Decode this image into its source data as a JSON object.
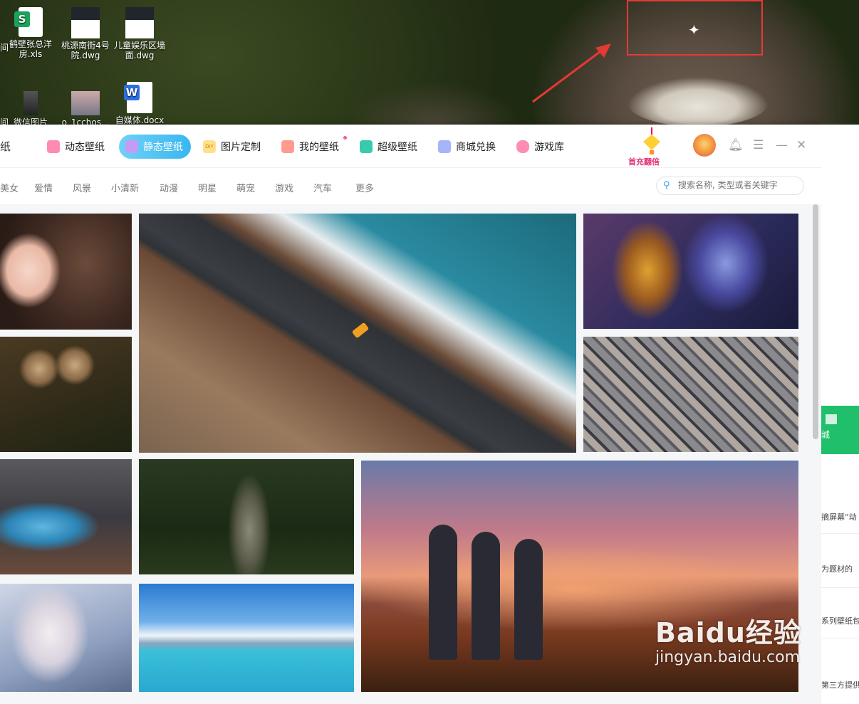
{
  "desktop": {
    "icons": [
      {
        "label": "鹤壁张总洋\n房.xls",
        "type": "xls"
      },
      {
        "label": "桃源南街4号\n院.dwg",
        "type": "dwg"
      },
      {
        "label": "儿童娱乐区墙\n面.dwg",
        "type": "dwg"
      },
      {
        "label": "微信图片",
        "type": "image"
      },
      {
        "label": "o_1cchos...",
        "type": "image"
      },
      {
        "label": "自媒体.docx",
        "type": "docx"
      }
    ],
    "left_edge_text": [
      "间",
      "间"
    ]
  },
  "app": {
    "logo_fragment": "纸",
    "nav": [
      {
        "label": "动态壁纸",
        "color": "#ff6fa0"
      },
      {
        "label": "静态壁纸",
        "color": "#ffffff",
        "active": true
      },
      {
        "label": "图片定制",
        "color": "#ffcb52",
        "badge": "DIY"
      },
      {
        "label": "我的壁纸",
        "color": "#ff8a80"
      },
      {
        "label": "超级壁纸",
        "color": "#2ec4a7"
      },
      {
        "label": "商城兑换",
        "color": "#8a9bf5"
      },
      {
        "label": "游戏库",
        "color": "#ff7aa8"
      }
    ],
    "promo_text": "首充翻倍",
    "categories": [
      "美女",
      "爱情",
      "风景",
      "小清新",
      "动漫",
      "明星",
      "萌宠",
      "游戏",
      "汽车",
      "更多"
    ],
    "search_placeholder": "搜索名称, 类型或者关键字",
    "window_icons": [
      "bell-icon",
      "menu-icon",
      "minimize-icon",
      "close-icon"
    ]
  },
  "right_page": {
    "green_label": "城",
    "lines": [
      "摘屏幕“动",
      "为题材的",
      "系列壁纸包",
      "第三方提供"
    ]
  },
  "watermark": {
    "brand": "Baidu经验",
    "url": "jingyan.baidu.com"
  }
}
